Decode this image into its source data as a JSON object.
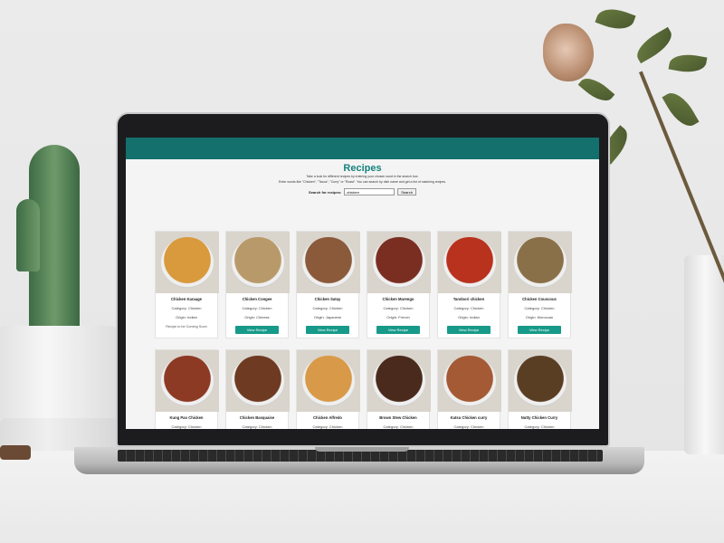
{
  "page": {
    "title": "Recipes",
    "intro_line1": "Take a look for different recipes by entering your chosen word in the search box.",
    "intro_line2": "Enter words like \"Chicken\", \"Tacos\", \"Curry\" or \"Roast\". You can search by dish name and get a list of matching recipes.",
    "search_label": "Search for recipes:",
    "search_value": "chicken",
    "search_button": "Search"
  },
  "recipes": [
    {
      "name": "Chicken Karaage",
      "category": "Category: Chicken",
      "origin": "Origin: Indian",
      "action": "Recipe to be Coming Soon",
      "action_type": "note",
      "color": "#d89a3c"
    },
    {
      "name": "Chicken Congee",
      "category": "Category: Chicken",
      "origin": "Origin: Chinese",
      "action": "View Recipe",
      "action_type": "button",
      "color": "#b89a6a"
    },
    {
      "name": "Chicken Satay",
      "category": "Category: Chicken",
      "origin": "Origin: Japanese",
      "action": "View Recipe",
      "action_type": "button",
      "color": "#8a5a3a"
    },
    {
      "name": "Chicken Marengo",
      "category": "Category: Chicken",
      "origin": "Origin: French",
      "action": "View Recipe",
      "action_type": "button",
      "color": "#7a2e22"
    },
    {
      "name": "Tandoori chicken",
      "category": "Category: Chicken",
      "origin": "Origin: Indian",
      "action": "View Recipe",
      "action_type": "button",
      "color": "#b8321e"
    },
    {
      "name": "Chicken Couscous",
      "category": "Category: Chicken",
      "origin": "Origin: Moroccan",
      "action": "View Recipe",
      "action_type": "button",
      "color": "#8a7048"
    },
    {
      "name": "Kung Pao Chicken",
      "category": "Category: Chicken",
      "origin": "",
      "action": "",
      "action_type": "",
      "color": "#8c3a24"
    },
    {
      "name": "Chicken Basquaise",
      "category": "Category: Chicken",
      "origin": "",
      "action": "",
      "action_type": "",
      "color": "#6e3a22"
    },
    {
      "name": "Chicken Alfredo",
      "category": "Category: Chicken",
      "origin": "",
      "action": "",
      "action_type": "",
      "color": "#d89a48"
    },
    {
      "name": "Brown Stew Chicken",
      "category": "Category: Chicken",
      "origin": "",
      "action": "",
      "action_type": "",
      "color": "#4a2a1c"
    },
    {
      "name": "Katsu Chicken curry",
      "category": "Category: Chicken",
      "origin": "",
      "action": "",
      "action_type": "",
      "color": "#a45a34"
    },
    {
      "name": "Nutty Chicken Curry",
      "category": "Category: Chicken",
      "origin": "",
      "action": "",
      "action_type": "",
      "color": "#5a3e24"
    }
  ]
}
